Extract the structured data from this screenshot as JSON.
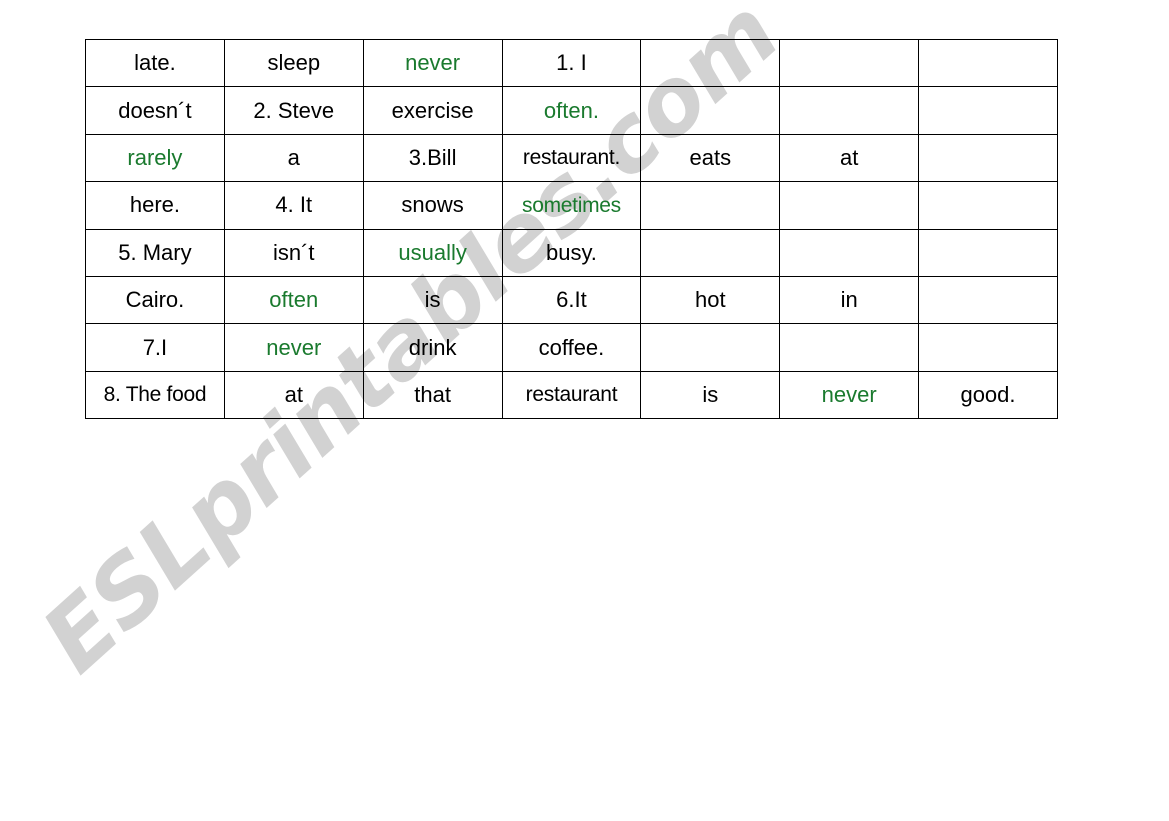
{
  "worksheet": {
    "colors": {
      "adverb": "#1a7a2e",
      "text": "#000000",
      "border": "#000000",
      "watermark": "#d2d2d2",
      "background": "#ffffff"
    },
    "columns": 7,
    "rows": 8,
    "grid": [
      [
        {
          "text": "late.",
          "green": false
        },
        {
          "text": "sleep",
          "green": false
        },
        {
          "text": "never",
          "green": true
        },
        {
          "text": "1. I",
          "green": false
        },
        {
          "text": "",
          "green": false
        },
        {
          "text": "",
          "green": false
        },
        {
          "text": "",
          "green": false
        }
      ],
      [
        {
          "text": "doesn´t",
          "green": false
        },
        {
          "text": "2. Steve",
          "green": false
        },
        {
          "text": "exercise",
          "green": false
        },
        {
          "text": "often.",
          "green": true
        },
        {
          "text": "",
          "green": false
        },
        {
          "text": "",
          "green": false
        },
        {
          "text": "",
          "green": false
        }
      ],
      [
        {
          "text": "rarely",
          "green": true
        },
        {
          "text": "a",
          "green": false
        },
        {
          "text": "3.Bill",
          "green": false
        },
        {
          "text": "restaurant.",
          "green": false
        },
        {
          "text": "eats",
          "green": false
        },
        {
          "text": "at",
          "green": false
        },
        {
          "text": "",
          "green": false
        }
      ],
      [
        {
          "text": "here.",
          "green": false
        },
        {
          "text": "4. It",
          "green": false
        },
        {
          "text": "snows",
          "green": false
        },
        {
          "text": "sometimes",
          "green": true
        },
        {
          "text": "",
          "green": false
        },
        {
          "text": "",
          "green": false
        },
        {
          "text": "",
          "green": false
        }
      ],
      [
        {
          "text": "5. Mary",
          "green": false
        },
        {
          "text": "isn´t",
          "green": false
        },
        {
          "text": "usually",
          "green": true
        },
        {
          "text": "busy.",
          "green": false
        },
        {
          "text": "",
          "green": false
        },
        {
          "text": "",
          "green": false
        },
        {
          "text": "",
          "green": false
        }
      ],
      [
        {
          "text": "Cairo.",
          "green": false
        },
        {
          "text": "often",
          "green": true
        },
        {
          "text": "is",
          "green": false
        },
        {
          "text": "6.It",
          "green": false
        },
        {
          "text": "hot",
          "green": false
        },
        {
          "text": "in",
          "green": false
        },
        {
          "text": "",
          "green": false
        }
      ],
      [
        {
          "text": "7.I",
          "green": false
        },
        {
          "text": "never",
          "green": true
        },
        {
          "text": "drink",
          "green": false
        },
        {
          "text": "coffee.",
          "green": false
        },
        {
          "text": "",
          "green": false
        },
        {
          "text": "",
          "green": false
        },
        {
          "text": "",
          "green": false
        }
      ],
      [
        {
          "text": "8. The food",
          "green": false
        },
        {
          "text": "at",
          "green": false
        },
        {
          "text": "that",
          "green": false
        },
        {
          "text": "restaurant",
          "green": false
        },
        {
          "text": "is",
          "green": false
        },
        {
          "text": "never",
          "green": true
        },
        {
          "text": "good.",
          "green": false
        }
      ]
    ]
  },
  "watermark": {
    "label": "ESLprintables.com"
  }
}
